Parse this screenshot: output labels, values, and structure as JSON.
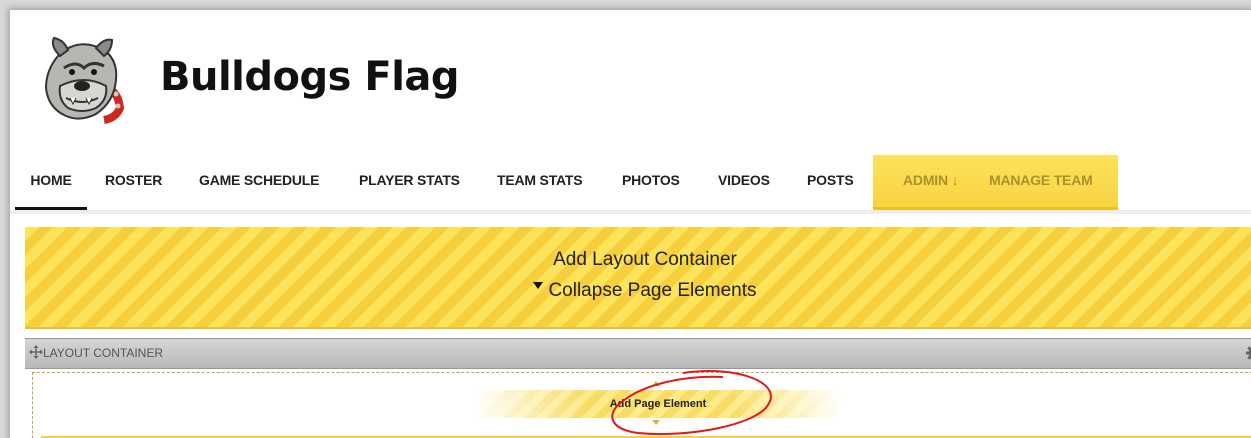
{
  "site": {
    "title": "Bulldogs Flag",
    "logo_icon": "bulldog-logo-icon"
  },
  "nav": {
    "items": [
      {
        "label": "HOME",
        "active": true
      },
      {
        "label": "ROSTER"
      },
      {
        "label": "GAME SCHEDULE"
      },
      {
        "label": "PLAYER STATS"
      },
      {
        "label": "TEAM STATS"
      },
      {
        "label": "PHOTOS"
      },
      {
        "label": "VIDEOS"
      },
      {
        "label": "POSTS"
      },
      {
        "label": "ADMIN ↓"
      },
      {
        "label": "MANAGE TEAM"
      }
    ]
  },
  "banner": {
    "add_layout": "Add Layout Container",
    "collapse": "Collapse Page Elements"
  },
  "layout_container": {
    "label": "LAYOUT CONTAINER",
    "add_element": "Add Page Element"
  },
  "colors": {
    "accent_yellow": "#fde35a",
    "stripe_dark": "#f6cf3c",
    "annotation_red": "#e01a1a"
  }
}
